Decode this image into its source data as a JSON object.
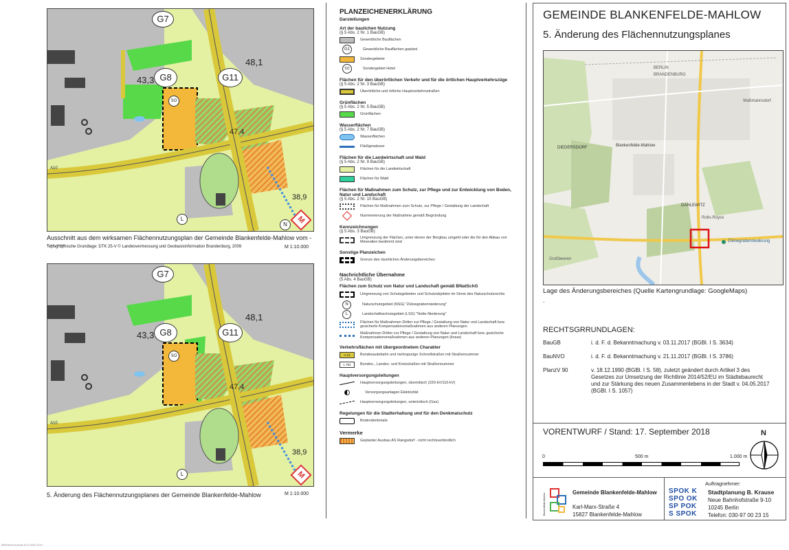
{
  "map_top": {
    "caption": "Ausschnitt aus dem wirksamen Flächennutzungsplan der Gemeinde Blankenfelde-Mahlow vom --.--.----",
    "source": "Topographische Grundlage: DTK 25-V © Landesvermessung und Geobasisinformation Brandenburg, 2009",
    "scale": "M 1:10.000",
    "labels": {
      "g7": "G7",
      "g8": "G8",
      "g11": "G11",
      "so": "SO",
      "n481": "48,1",
      "n433": "43,3",
      "n474": "47,4",
      "n389": "38,9",
      "a10": "A10",
      "l": "L",
      "n": "N",
      "m": "M"
    }
  },
  "map_bottom": {
    "caption": "5. Änderung des Flächennutzungsplanes der Gemeinde Blankenfelde-Mahlow",
    "scale": "M 1:10.000",
    "labels": {
      "g7": "G7",
      "g8": "G8",
      "g11": "G11",
      "so": "SO",
      "n481": "48,1",
      "n433": "43,3",
      "n474": "47,4",
      "n389": "38,9",
      "a10": "A10",
      "l": "L",
      "m": "M"
    }
  },
  "legend": {
    "title": "PLANZEICHENERKLÄRUNG",
    "subtitle": "Darstellungen",
    "sec1": {
      "h": "Art der baulichen Nutzung",
      "s": "(§ 5 Abs. 2 Nr. 1 BauGB)"
    },
    "i1": "Gewerbliche Bauflächen",
    "i2_sym": "G1",
    "i2": "Gewerbliche Bauflächen geplant",
    "i3": "Sondergebiete",
    "i4_sym": "SO",
    "i4": "Sondergebiet Hotel",
    "sec2": {
      "h": "Flächen für den überörtlichen Verkehr und für die örtlichen Hauptverkehrszüge",
      "s": "(§ 5 Abs. 2 Nr. 3 BauGB)"
    },
    "i5": "Überörtliche und örtliche Hauptverkehrsstraßen",
    "sec3": {
      "h": "Grünflächen",
      "s": "(§ 5 Abs. 2 Nr. 5 BauGB)"
    },
    "i6": "Grünflächen",
    "sec4": {
      "h": "Wasserflächen",
      "s": "(§ 5 Abs. 2 Nr. 7 BauGB)"
    },
    "i7": "Wasserflächen",
    "i8": "Fließgewässer",
    "sec5": {
      "h": "Flächen für die Landwirtschaft und Wald",
      "s": "(§ 5 Abs. 2 Nr. 9 BauGB)"
    },
    "i9": "Flächen für die Landwirtschaft",
    "i10": "Flächen für Wald",
    "sec6": {
      "h": "Flächen für Maßnahmen zum Schutz, zur Pflege und zur Entwicklung von Boden, Natur und Landschaft",
      "s": "(§ 5 Abs. 2 Nr. 10 BauGB)"
    },
    "i11": "Flächen für Maßnahmen zum Schutz, zur Pflege / Gestaltung der Landschaft",
    "i12": "Nummerierung der Maßnahme gemäß Begründung",
    "sec7": {
      "h": "Kennzeichnungen",
      "s": "(§ 5 Abs. 3 BauGB)"
    },
    "i13": "Umgrenzung der Flächen, unter denen der Bergbau umgeht oder die für den Abbau von Mineralien bestimmt sind",
    "sec8": {
      "h": "Sonstige Planzeichen"
    },
    "i14": "Grenze des räumlichen Änderungsbereiches",
    "sec9": {
      "h": "Nachrichtliche Übernahme",
      "s": "(5 Abs. 4 BauGB)"
    },
    "sec9b": {
      "h": "Flächen zum Schutz von Natur und Landschaft gemäß BNatSchG"
    },
    "i15": "Umgrenzung von Schutzgebieten und Schutzobjekten im Sinne des Naturschutzrechts",
    "i16_sym": "N",
    "i16": "Naturschutzgebiet (NSG) \"Zülowgrabenniederung\"",
    "i17_sym": "L",
    "i17": "Landschaftsschutzgebiet (LSG) \"Notte-Niederung\"",
    "i18": "Flächen für Maßnahmen Dritter zur Pflege / Gestaltung von Natur und Landschaft bzw. gesicherte Kompensationsmaßnahmen aus anderen Planungen",
    "i19": "Maßnahmen Dritter zur Pflege / Gestaltung von Natur und Landschaft bzw. gesicherte Kompensationsmaßnahmen aus anderen Planungen (linear)",
    "sec10": {
      "h": "Verkehrsflächen mit übergeordnetem Charakter"
    },
    "i20_sym": "A 10",
    "i20": "Bundesautobahn und mehrspurige Schnellstraßen mit Straßennummer",
    "i21_sym": "L 792",
    "i21": "Bundes-, Landes- und Kreisstraßen mit Straßennummer",
    "sec11": {
      "h": "Hauptversorgungsleitungen"
    },
    "i22": "Hauptversorgungsleitungen, oberirdisch (220-kV/110-kV)",
    "i23": "Versorgungsanlagen Elektrizität",
    "i24": "Hauptversorgungsleitungen, unterirdisch (Gas)",
    "sec12": {
      "h": "Regelungen für die Stadterhaltung und für den Denkmalschutz"
    },
    "i25": "Bodendenkmale",
    "sec13": {
      "h": "Vermerke"
    },
    "i26": "Geplanter Ausbau AS Rangsdorf - nicht rechtsverbindlich"
  },
  "title_block": {
    "municipality": "GEMEINDE BLANKENFELDE-MAHLOW",
    "subject": "5. Änderung des Flächennutzungsplanes",
    "location_caption": "Lage des Änderungsbereiches (Quelle Kartengrundlage: GoogleMaps)",
    "dot": ".",
    "overview_labels": {
      "berlin": "BERLIN",
      "brandenburg": "BRANDENBURG",
      "blankenfelde": "Blankenfelde-Mahlow",
      "diedersdorf": "DIEDERSDORF",
      "dahlewitz": "DAHLEWITZ",
      "rolls": "Rolls-Royce",
      "zuelow": "Zülowgrabenniederung",
      "groß": "Großbeeren",
      "waßmannsdorf": "Waßmannsdorf"
    }
  },
  "legal": {
    "heading": "RECHTSGRRUNDLAGEN:",
    "rows": [
      {
        "k": "BauGB",
        "v": "i. d. F. d. Bekanntmachung v. 03.11.2017 (BGBl. I S. 3634)"
      },
      {
        "k": "BauNVO",
        "v": "i. d. F. d. Bekanntmachung v. 21.11.2017 (BGBl. I S. 3786)"
      },
      {
        "k": "PlanzV 90",
        "v": "v. 18.12.1990 (BGBl. I S. 58), zuletzt geändert durch Artikel 3 des Gesetzes zur Umsetzung der Richtlinie 2014/52/EU im Städtebaurecht und zur Stärkung des neuen Zusammenlebens in der Stadt v. 04.05.2017 (BGBl. I S. 1057)"
      }
    ]
  },
  "status": "VORENTWURF / Stand: 17. September 2018",
  "scalebar": {
    "zero": "0",
    "mid": "500 m",
    "end": "1.000 m"
  },
  "north": "N",
  "client": {
    "name": "Gemeinde Blankenfelde-Mahlow",
    "street": "Karl-Marx-Straße 4",
    "city": "15827 Blankenfelde-Mahlow",
    "logo_text": "Blankenfelde-Mahlow"
  },
  "contractor": {
    "label": "Auftragnehmer:",
    "spok": [
      "SPOK K",
      "SPO OK",
      "SP POK",
      "S SPOK"
    ],
    "name": "Stadtplanung B. Krause",
    "street": "Neue Bahnhofstraße 9-10",
    "city": "10245 Berlin",
    "phone": "Telefon: 030-97 00 23 15"
  },
  "footer": "5BPlaenKonzepte B-S 1050 1010"
}
